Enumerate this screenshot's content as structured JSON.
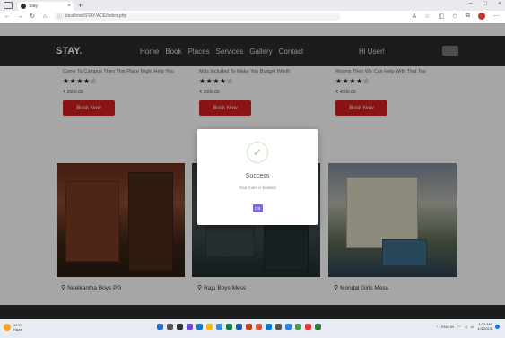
{
  "browser": {
    "tab_title": "Stay",
    "url": "localhost/STAY/ACE/index.php",
    "new_tab": "+",
    "close_tab": "×",
    "win_controls": [
      "−",
      "□",
      "×"
    ]
  },
  "site": {
    "logo": "STAY",
    "logo_dot": ".",
    "nav": [
      "Home",
      "Book",
      "Places",
      "Services",
      "Gallery",
      "Contact"
    ],
    "greeting": "Hi User!"
  },
  "cards": [
    {
      "desc": "Come To Campus Then This Place Might Help You",
      "stars": "★★★★☆",
      "price": "₹ 2500.00",
      "book_label": "Book Now"
    },
    {
      "desc": "Mills Included To Make You Budget Worth",
      "stars": "★★★★☆",
      "price": "₹ 3500.00",
      "book_label": "Book Now"
    },
    {
      "desc": "Rooms Then We Can Help With That Too",
      "stars": "★★★★☆",
      "price": "₹ 4500.00",
      "book_label": "Book Now"
    }
  ],
  "places": [
    "Neelkantha Boys PG",
    "Raju Boys Mess",
    "Mondal Girls Mess"
  ],
  "modal": {
    "title": "Success",
    "text": "Your room is booked",
    "ok_label": "OK"
  },
  "taskbar": {
    "weather_temp": "31°C",
    "weather_desc": "Haze",
    "time": "1:03 AM",
    "date": "1/4/2023",
    "lang": "ENG IN"
  },
  "colors": {
    "nav_bg": "#2b2b2b",
    "accent_red": "#d42020",
    "ok_button": "#7a6fd6",
    "success_check": "#8ccf6b"
  }
}
